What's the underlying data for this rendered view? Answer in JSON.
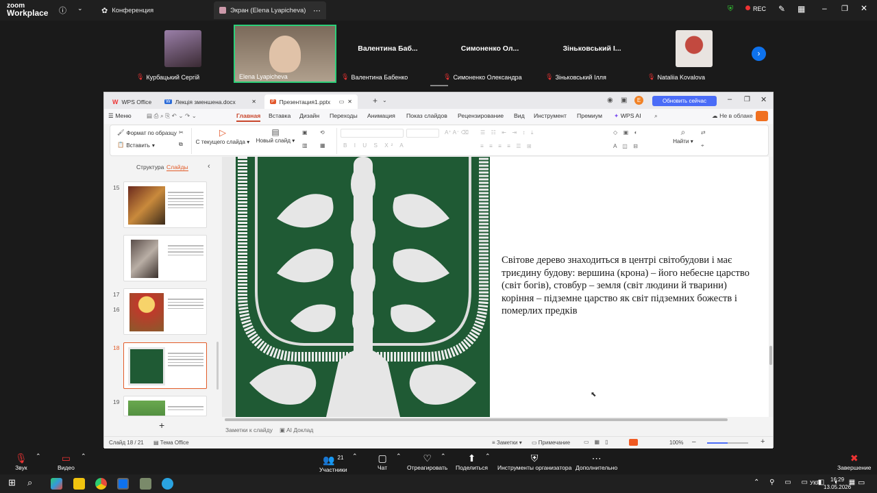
{
  "zoom": {
    "logo_line1": "zoom",
    "logo_line2": "Workplace",
    "tabs": [
      {
        "label": "Конференция"
      },
      {
        "label": "Экран (Elena Lyapicheva)"
      }
    ],
    "rec_label": "REC",
    "participants": [
      {
        "name": "Курбацький Сергій",
        "display": ""
      },
      {
        "name": "Elena Lyapicheva",
        "display": ""
      },
      {
        "name": "Валентина Бабенко",
        "display": "Валентина Баб..."
      },
      {
        "name": "Симоненко Олександра",
        "display": "Симоненко Ол..."
      },
      {
        "name": "Зіньковський Ілля",
        "display": "Зіньковський І..."
      },
      {
        "name": "Nataliia Kovalova",
        "display": ""
      }
    ],
    "toolbar": {
      "sound": "Звук",
      "video": "Видео",
      "participants": "Участники",
      "participants_count": "21",
      "chat": "Чат",
      "react": "Отреагировать",
      "share": "Поделиться",
      "host_tools": "Инструменты организатора",
      "more": "Дополнительно",
      "end": "Завершение"
    }
  },
  "wps": {
    "tabs": [
      {
        "label": "WPS Office"
      },
      {
        "label": "Лекція зменшена.docx"
      },
      {
        "label": "Презентация1.pptx"
      }
    ],
    "update_button": "Обновить сейчас",
    "menu": [
      "Меню",
      "Главная",
      "Вставка",
      "Дизайн",
      "Переходы",
      "Анимация",
      "Показ слайдов",
      "Рецензирование",
      "Вид",
      "Инструмент",
      "Премиум",
      "WPS AI"
    ],
    "cloud": "Не в облаке",
    "ribbon": {
      "format_painter": "Формат по образцу",
      "paste": "Вставить",
      "from_current": "С текущего слайда",
      "new_slide": "Новый слайд",
      "find": "Найти"
    },
    "panel_tabs": {
      "structure": "Структура",
      "slides": "Слайды"
    },
    "slides": [
      {
        "num": "15"
      },
      {
        "num": "16"
      },
      {
        "num": "17"
      },
      {
        "num": "18",
        "selected": true
      },
      {
        "num": "19"
      }
    ],
    "slide_text": [
      "Світове дерево знаходиться в центрі світобудови і має",
      "триєдину будову: вершина (крона) – його небесне царство",
      "(світ богів), стовбур – земля (світ людини й тварини)",
      "коріння – підземне царство як світ підземних божеств і",
      "померлих предків"
    ],
    "notes_placeholder": "Заметки к слайду",
    "ai_report": "AI Доклад",
    "status": {
      "slide_info": "Слайд 18 / 21",
      "theme": "Тема Office",
      "notes": "Заметки",
      "comment": "Примечание",
      "zoom": "100%"
    }
  },
  "taskbar": {
    "lang": "УКР",
    "time": "16:29",
    "date": "13.05.2026"
  }
}
